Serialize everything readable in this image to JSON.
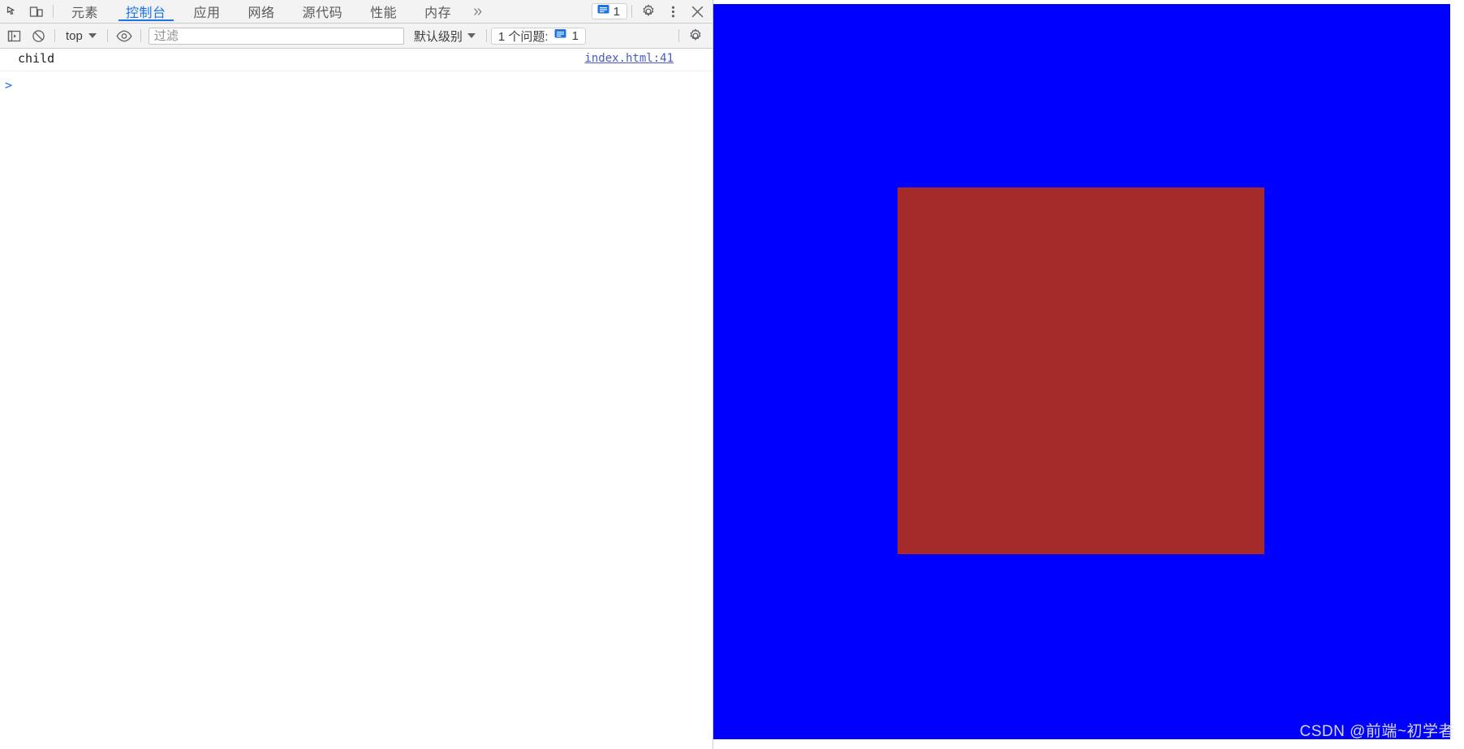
{
  "devtools": {
    "tabstrip": {
      "inspect_icon": "inspect-element-icon",
      "device_icon": "device-toolbar-icon",
      "tabs": [
        {
          "id": "elements",
          "label": "元素",
          "active": false
        },
        {
          "id": "console",
          "label": "控制台",
          "active": true
        },
        {
          "id": "application",
          "label": "应用",
          "active": false
        },
        {
          "id": "network",
          "label": "网络",
          "active": false
        },
        {
          "id": "sources",
          "label": "源代码",
          "active": false
        },
        {
          "id": "performance",
          "label": "性能",
          "active": false
        },
        {
          "id": "memory",
          "label": "内存",
          "active": false
        }
      ],
      "more_tabs_label": "»",
      "issues_count": "1",
      "issues_icon": "issues-message-icon",
      "settings_icon": "gear-icon",
      "more_options_icon": "kebab-menu-icon",
      "close_icon": "close-icon"
    },
    "filterbar": {
      "sidebar_toggle_icon": "console-sidebar-icon",
      "clear_console_icon": "clear-console-icon",
      "context_label": "top",
      "live_expression_icon": "eye-icon",
      "filter_placeholder": "过滤",
      "filter_value": "",
      "level_label": "默认级别",
      "issues_label": "1 个问题:",
      "issues_count": "1",
      "issues_icon": "issues-message-icon",
      "console_settings_icon": "gear-icon"
    },
    "console": {
      "messages": [
        {
          "text": "child",
          "source": "index.html:41"
        }
      ],
      "prompt_caret": ">",
      "prompt_value": "",
      "prompt_placeholder": ""
    }
  },
  "viewport": {
    "parent_box_name": "blue-parent-box",
    "child_box_name": "red-child-box",
    "colors": {
      "parent": "#0000ff",
      "child": "#a52a2a",
      "page_background": "#ffffff"
    },
    "watermark": "CSDN @前端~初学者"
  }
}
